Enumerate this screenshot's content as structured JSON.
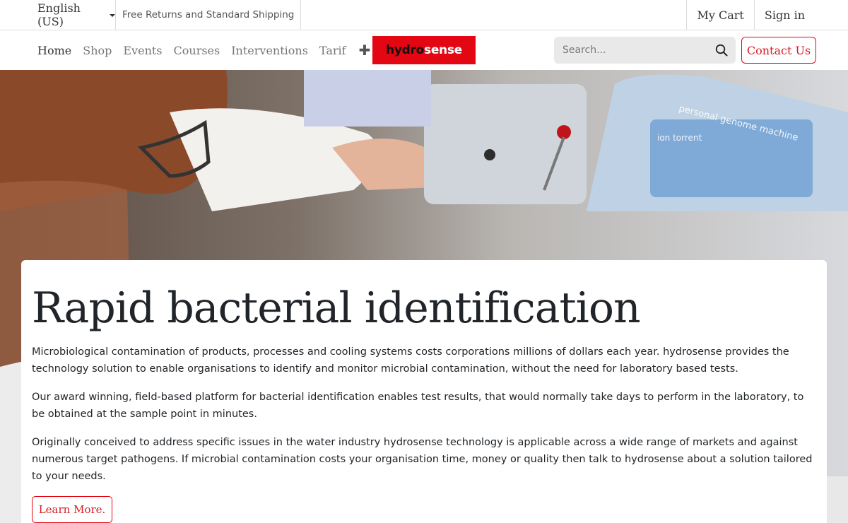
{
  "topbar": {
    "language": "English (US)",
    "promo": "Free Returns and Standard Shipping",
    "cart": "My Cart",
    "signin": "Sign in"
  },
  "nav": {
    "items": [
      {
        "label": "Home",
        "active": true
      },
      {
        "label": "Shop"
      },
      {
        "label": "Events"
      },
      {
        "label": "Courses"
      },
      {
        "label": "Interventions"
      },
      {
        "label": "Tarif"
      }
    ],
    "add_icon": "plus-icon"
  },
  "logo": {
    "part1": "hydro",
    "part2": "sense",
    "bg_color": "#e30613"
  },
  "search": {
    "placeholder": "Search...",
    "icon": "search-icon"
  },
  "contact": {
    "label": "Contact Us"
  },
  "hero": {
    "title": "Rapid bacterial identification",
    "paragraphs": [
      "Microbiological contamination of products, processes and cooling systems costs corporations millions of dollars each year.  hydrosense provides the technology solution to enable organisations to identify and monitor microbial contamination, without the need for laboratory based tests.",
      "Our award winning, field-based platform for bacterial identification enables test results, that would normally take days to perform in the laboratory, to be obtained at the sample point in minutes.",
      "Originally conceived to address specific issues in the water industry hydrosense technology is applicable across a wide range of markets and against numerous target pathogens.  If microbial contamination costs your organisation time, money or quality then talk to hydrosense about a solution tailored to your needs."
    ],
    "button": "Learn More."
  },
  "colors": {
    "accent": "#e30613",
    "text": "#212529"
  }
}
